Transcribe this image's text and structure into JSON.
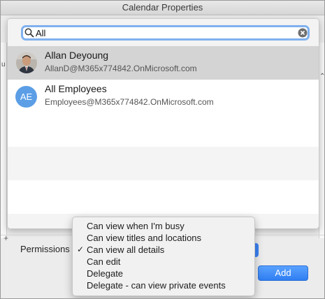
{
  "window": {
    "title": "Calendar Properties"
  },
  "search": {
    "value": "All",
    "placeholder": ""
  },
  "results": [
    {
      "name": "Allan Deyoung",
      "email": "AllanD@M365x774842.OnMicrosoft.com",
      "avatar": "photo",
      "selected": true
    },
    {
      "name": "All Employees",
      "email": "Employees@M365x774842.OnMicrosoft.com",
      "avatar": "AE",
      "selected": false
    }
  ],
  "permissions": {
    "label": "Permissions"
  },
  "permission_menu": {
    "items": [
      {
        "label": "Can view when I'm busy",
        "checked": false
      },
      {
        "label": "Can view titles and locations",
        "checked": false
      },
      {
        "label": "Can view all details",
        "checked": true
      },
      {
        "label": "Can edit",
        "checked": false
      },
      {
        "label": "Delegate",
        "checked": false
      },
      {
        "label": "Delegate - can view private events",
        "checked": false
      }
    ],
    "check_glyph": "✓"
  },
  "buttons": {
    "add_label": "Add"
  },
  "colors": {
    "accent": "#2f7ef2",
    "avatar_bg": "#5b9ee6",
    "selection": "#d4d4d4"
  }
}
